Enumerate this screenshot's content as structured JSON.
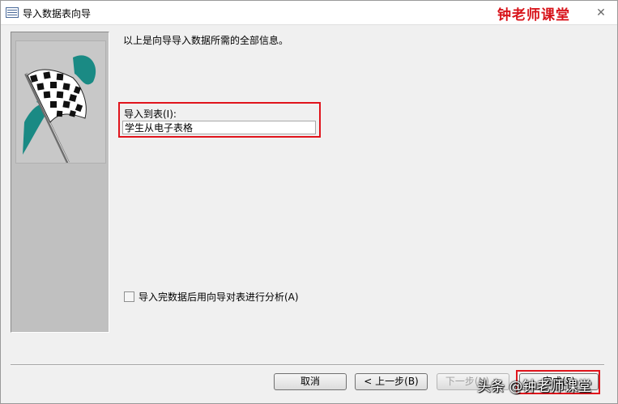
{
  "window": {
    "title": "导入数据表向导",
    "close_glyph": "✕"
  },
  "watermark": {
    "top": "钟老师课堂",
    "bottom": "头条 @钟老师课堂"
  },
  "content": {
    "info_text": "以上是向导导入数据所需的全部信息。",
    "import_label": "导入到表(I):",
    "import_value": "学生从电子表格",
    "analyze_checkbox_label": "导入完数据后用向导对表进行分析(A)",
    "analyze_checked": false
  },
  "buttons": {
    "cancel": "取消",
    "prev": "< 上一步(B)",
    "next": "下一步(N) >",
    "finish": "完成(F)"
  },
  "icons": {
    "app": "table-icon",
    "art": "checkered-flag-icon"
  },
  "colors": {
    "highlight": "#e0141c",
    "watermark": "#d8141b",
    "flag_teal": "#1a8a84"
  }
}
